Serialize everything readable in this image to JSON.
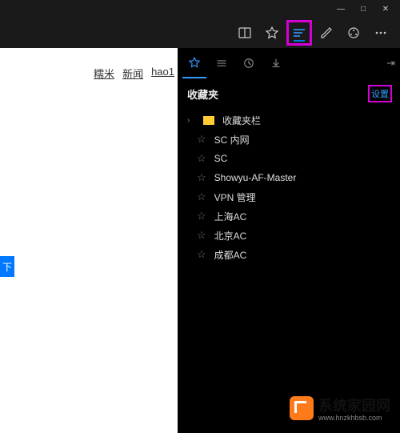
{
  "window": {
    "min": "—",
    "max": "□",
    "close": "✕"
  },
  "toolbar": {
    "read_icon": "reading-view",
    "fav_icon": "star",
    "hub_icon": "hub",
    "note_icon": "web-note",
    "share_icon": "share",
    "more_icon": "more"
  },
  "page_nav": {
    "item1": "糯米",
    "item2": "新闻",
    "item3": "hao1"
  },
  "blue_button": "下",
  "panel": {
    "tabs": {
      "fav": "★",
      "read": "≡",
      "hist": "↺",
      "dl": "↓"
    },
    "pin": "⇥",
    "title": "收藏夹",
    "settings": "设置",
    "folder_item": "收藏夹栏",
    "items": [
      "SC 内网",
      "SC",
      "Showyu-AF-Master",
      "VPN 管理",
      "上海AC",
      "北京AC",
      "成都AC"
    ]
  },
  "watermark": {
    "brand": "系统家园网",
    "url": "www.hnzkhbsb.com"
  }
}
